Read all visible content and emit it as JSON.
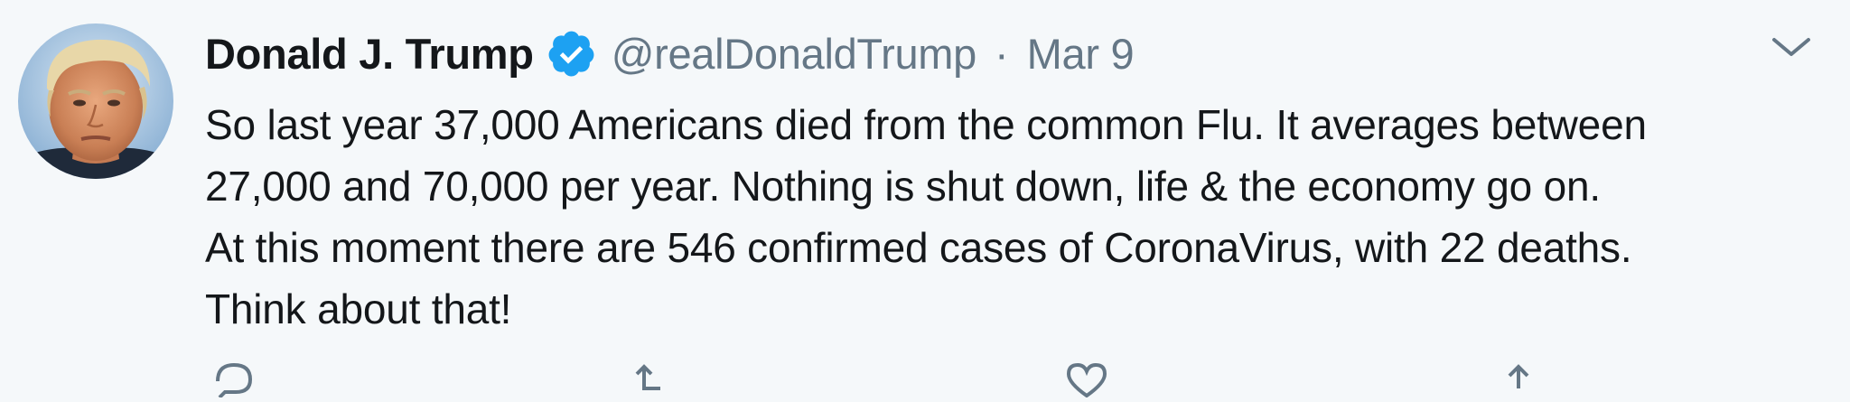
{
  "tweet": {
    "author": {
      "display_name": "Donald J. Trump",
      "handle": "@realDonaldTrump",
      "verified": true
    },
    "separator": "·",
    "timestamp": "Mar 9",
    "body_lines": [
      "So last year 37,000 Americans died from the common Flu. It averages between",
      "27,000 and 70,000 per year. Nothing is shut down, life & the economy go on.",
      "At this moment there are 546 confirmed cases of CoronaVirus, with 22 deaths.",
      "Think about that!"
    ],
    "actions": [
      "reply-icon",
      "retweet-icon",
      "like-icon",
      "share-icon"
    ]
  },
  "colors": {
    "background": "#f5f8fa",
    "text_primary": "#14171a",
    "text_secondary": "#657786",
    "verified_blue": "#1da1f2"
  }
}
